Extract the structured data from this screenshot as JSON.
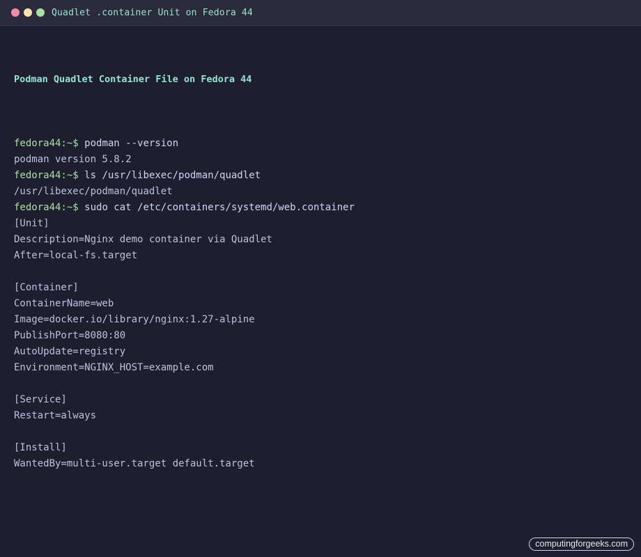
{
  "window": {
    "title": "Quadlet .container Unit on Fedora 44"
  },
  "terminal": {
    "heading": "Podman Quadlet Container File on Fedora 44",
    "prompt": "fedora44:~$",
    "lines": [
      {
        "type": "cmd",
        "text": "podman --version"
      },
      {
        "type": "out",
        "text": "podman version 5.8.2"
      },
      {
        "type": "cmd",
        "text": "ls /usr/libexec/podman/quadlet"
      },
      {
        "type": "out",
        "text": "/usr/libexec/podman/quadlet"
      },
      {
        "type": "cmd",
        "text": "sudo cat /etc/containers/systemd/web.container"
      },
      {
        "type": "out",
        "text": "[Unit]"
      },
      {
        "type": "out",
        "text": "Description=Nginx demo container via Quadlet"
      },
      {
        "type": "out",
        "text": "After=local-fs.target"
      },
      {
        "type": "blank",
        "text": ""
      },
      {
        "type": "out",
        "text": "[Container]"
      },
      {
        "type": "out",
        "text": "ContainerName=web"
      },
      {
        "type": "out",
        "text": "Image=docker.io/library/nginx:1.27-alpine"
      },
      {
        "type": "out",
        "text": "PublishPort=8080:80"
      },
      {
        "type": "out",
        "text": "AutoUpdate=registry"
      },
      {
        "type": "out",
        "text": "Environment=NGINX_HOST=example.com"
      },
      {
        "type": "blank",
        "text": ""
      },
      {
        "type": "out",
        "text": "[Service]"
      },
      {
        "type": "out",
        "text": "Restart=always"
      },
      {
        "type": "blank",
        "text": ""
      },
      {
        "type": "out",
        "text": "[Install]"
      },
      {
        "type": "out",
        "text": "WantedBy=multi-user.target default.target"
      }
    ]
  },
  "watermark": {
    "text": "computingforgeeks.com"
  },
  "colors": {
    "background": "#1e1e2e",
    "titlebar": "#2b2b3c",
    "prompt": "#a6e3a1",
    "heading": "#94e2d5",
    "text": "#cdd6f4"
  }
}
